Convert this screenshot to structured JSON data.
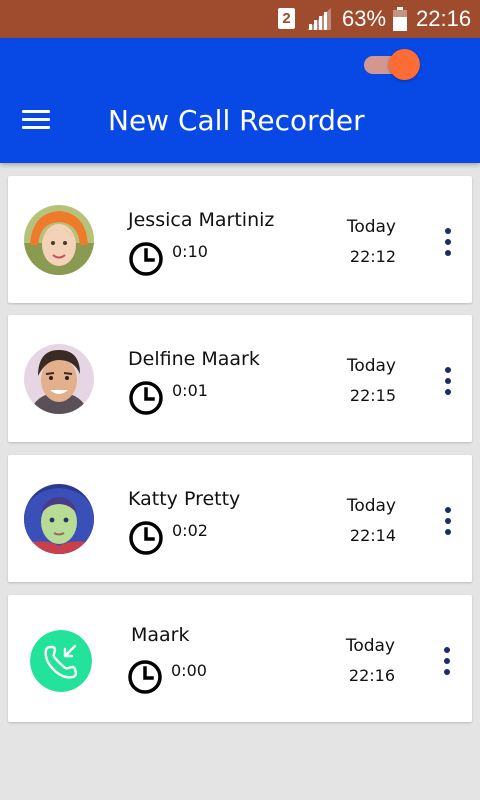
{
  "status_bar": {
    "sim_slot": "2",
    "battery_percent": "63%",
    "time": "22:16",
    "background_color": "#9e4c2d",
    "icons": [
      "sim-icon",
      "signal-icon",
      "battery-icon"
    ]
  },
  "app_bar": {
    "title": "New Call Recorder",
    "background_color": "#0849e6",
    "recording_toggle": {
      "on": true,
      "color": "#fd6b37"
    },
    "menu_icon": "hamburger-menu-icon"
  },
  "calls": [
    {
      "name": "Jessica Martiniz",
      "duration": "0:10",
      "date": "Today",
      "time": "22:12",
      "avatar": "contact-photo"
    },
    {
      "name": "Delfine Maark",
      "duration": "0:01",
      "date": "Today",
      "time": "22:15",
      "avatar": "contact-photo"
    },
    {
      "name": "Katty Pretty",
      "duration": "0:02",
      "date": "Today",
      "time": "22:14",
      "avatar": "contact-photo"
    },
    {
      "name": "Maark",
      "duration": "0:00",
      "date": "Today",
      "time": "22:16",
      "avatar": "incoming-call-icon"
    }
  ]
}
